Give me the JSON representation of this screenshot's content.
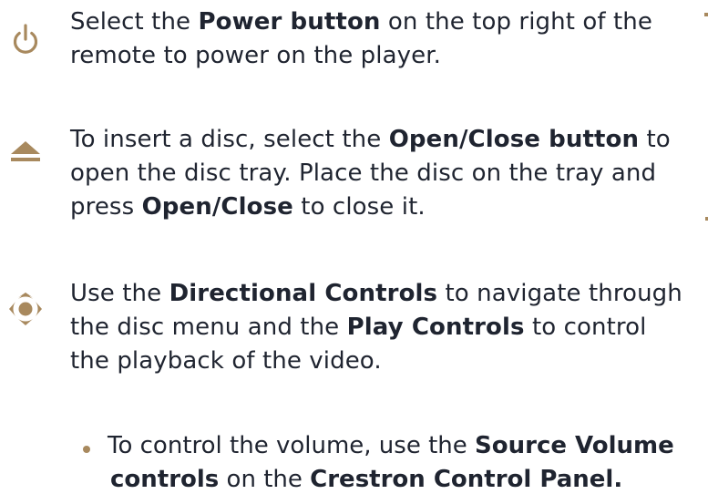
{
  "colors": {
    "accent": "#a8895e",
    "text": "#1f2430"
  },
  "steps": [
    {
      "icon": "power-icon",
      "segments": [
        {
          "text": "Select the ",
          "bold": false
        },
        {
          "text": "Power button",
          "bold": true
        },
        {
          "text": " on the top right of the remote to power on the player.",
          "bold": false
        }
      ]
    },
    {
      "icon": "eject-icon",
      "segments": [
        {
          "text": "To insert a disc, select the ",
          "bold": false
        },
        {
          "text": "Open/Close button",
          "bold": true
        },
        {
          "text": " to open the disc tray. Place the disc on the tray and press ",
          "bold": false
        },
        {
          "text": "Open/Close",
          "bold": true
        },
        {
          "text": " to close it.",
          "bold": false
        }
      ]
    },
    {
      "icon": "directional-pad-icon",
      "segments": [
        {
          "text": "Use the ",
          "bold": false
        },
        {
          "text": "Directional Controls",
          "bold": true
        },
        {
          "text": " to navigate through the disc menu and the ",
          "bold": false
        },
        {
          "text": "Play Controls",
          "bold": true
        },
        {
          "text": " to control the playback of the video.",
          "bold": false
        }
      ]
    }
  ],
  "bullet": {
    "line1": [
      {
        "text": "To control the volume, use the ",
        "bold": false
      },
      {
        "text": "Source Volume",
        "bold": true
      }
    ],
    "line2": [
      {
        "text": "controls",
        "bold": true
      },
      {
        "text": " on the ",
        "bold": false
      },
      {
        "text": "Crestron Control Panel.",
        "bold": true
      }
    ]
  }
}
